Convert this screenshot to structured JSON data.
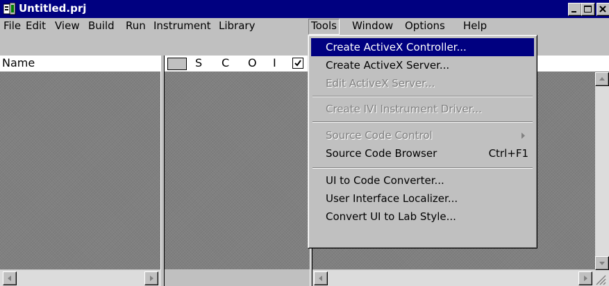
{
  "window": {
    "title": "Untitled.prj",
    "icon": "project-icon",
    "controls": [
      "minimize-icon",
      "maximize-icon",
      "close-icon"
    ]
  },
  "menubar": {
    "items": [
      {
        "label": "File",
        "mnemonic": "F"
      },
      {
        "label": "Edit",
        "mnemonic": "E"
      },
      {
        "label": "View",
        "mnemonic": "V"
      },
      {
        "label": "Build",
        "mnemonic": "B"
      },
      {
        "label": "Run",
        "mnemonic": "R"
      },
      {
        "label": "Instrument",
        "mnemonic": "I"
      },
      {
        "label": "Library",
        "mnemonic": "L"
      },
      {
        "label": "Tools",
        "mnemonic": "T",
        "active": true
      },
      {
        "label": "Window",
        "mnemonic": "W"
      },
      {
        "label": "Options",
        "mnemonic": "O"
      },
      {
        "label": "Help",
        "mnemonic": "H"
      }
    ]
  },
  "project_list": {
    "name_header": "Name",
    "flag_headers": [
      "S",
      "C",
      "O",
      "I"
    ]
  },
  "tools_menu": {
    "items": [
      {
        "label": "Create ActiveX Controller...",
        "highlighted": true
      },
      {
        "label": "Create ActiveX Server..."
      },
      {
        "label": "Edit ActiveX Server...",
        "disabled": true
      },
      {
        "separator": true
      },
      {
        "label": "Create IVI Instrument Driver...",
        "disabled": true
      },
      {
        "separator": true
      },
      {
        "label": "Source Code Control",
        "disabled": true,
        "submenu": true
      },
      {
        "label": "Source Code Browser",
        "shortcut": "Ctrl+F1"
      },
      {
        "separator": true
      },
      {
        "label": "UI to Code Converter..."
      },
      {
        "label": "User Interface Localizer..."
      },
      {
        "label": "Convert UI to Lab Style..."
      }
    ]
  },
  "colors": {
    "titlebar": "#000080",
    "highlight": "#000080",
    "face": "#c0c0c0",
    "panel": "#808080"
  }
}
